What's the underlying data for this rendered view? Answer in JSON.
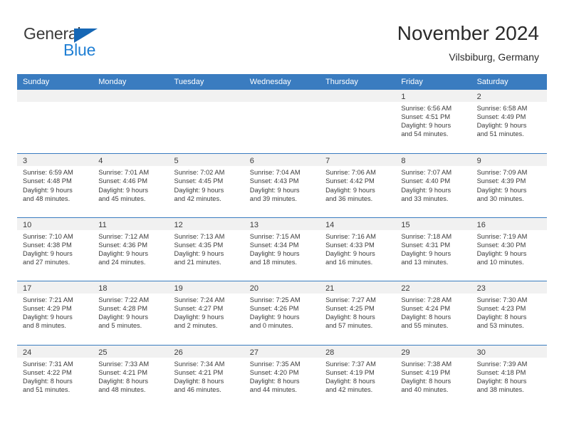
{
  "logo": {
    "word_top": "General",
    "word_bottom": "Blue",
    "triangle_color": "#1667b5",
    "blue_color": "#1f7fd4"
  },
  "header": {
    "month_title": "November 2024",
    "location": "Vilsbiburg, Germany"
  },
  "theme": {
    "header_row_bg": "#3a7cc0",
    "day_strip_bg": "#f1f1f1",
    "text_color": "#3b3b3b"
  },
  "weekdays": [
    "Sunday",
    "Monday",
    "Tuesday",
    "Wednesday",
    "Thursday",
    "Friday",
    "Saturday"
  ],
  "weeks": [
    [
      {
        "day": "",
        "empty": true
      },
      {
        "day": "",
        "empty": true
      },
      {
        "day": "",
        "empty": true
      },
      {
        "day": "",
        "empty": true
      },
      {
        "day": "",
        "empty": true
      },
      {
        "day": "1",
        "sunrise": "Sunrise: 6:56 AM",
        "sunset": "Sunset: 4:51 PM",
        "daylight1": "Daylight: 9 hours",
        "daylight2": "and 54 minutes."
      },
      {
        "day": "2",
        "sunrise": "Sunrise: 6:58 AM",
        "sunset": "Sunset: 4:49 PM",
        "daylight1": "Daylight: 9 hours",
        "daylight2": "and 51 minutes."
      }
    ],
    [
      {
        "day": "3",
        "sunrise": "Sunrise: 6:59 AM",
        "sunset": "Sunset: 4:48 PM",
        "daylight1": "Daylight: 9 hours",
        "daylight2": "and 48 minutes."
      },
      {
        "day": "4",
        "sunrise": "Sunrise: 7:01 AM",
        "sunset": "Sunset: 4:46 PM",
        "daylight1": "Daylight: 9 hours",
        "daylight2": "and 45 minutes."
      },
      {
        "day": "5",
        "sunrise": "Sunrise: 7:02 AM",
        "sunset": "Sunset: 4:45 PM",
        "daylight1": "Daylight: 9 hours",
        "daylight2": "and 42 minutes."
      },
      {
        "day": "6",
        "sunrise": "Sunrise: 7:04 AM",
        "sunset": "Sunset: 4:43 PM",
        "daylight1": "Daylight: 9 hours",
        "daylight2": "and 39 minutes."
      },
      {
        "day": "7",
        "sunrise": "Sunrise: 7:06 AM",
        "sunset": "Sunset: 4:42 PM",
        "daylight1": "Daylight: 9 hours",
        "daylight2": "and 36 minutes."
      },
      {
        "day": "8",
        "sunrise": "Sunrise: 7:07 AM",
        "sunset": "Sunset: 4:40 PM",
        "daylight1": "Daylight: 9 hours",
        "daylight2": "and 33 minutes."
      },
      {
        "day": "9",
        "sunrise": "Sunrise: 7:09 AM",
        "sunset": "Sunset: 4:39 PM",
        "daylight1": "Daylight: 9 hours",
        "daylight2": "and 30 minutes."
      }
    ],
    [
      {
        "day": "10",
        "sunrise": "Sunrise: 7:10 AM",
        "sunset": "Sunset: 4:38 PM",
        "daylight1": "Daylight: 9 hours",
        "daylight2": "and 27 minutes."
      },
      {
        "day": "11",
        "sunrise": "Sunrise: 7:12 AM",
        "sunset": "Sunset: 4:36 PM",
        "daylight1": "Daylight: 9 hours",
        "daylight2": "and 24 minutes."
      },
      {
        "day": "12",
        "sunrise": "Sunrise: 7:13 AM",
        "sunset": "Sunset: 4:35 PM",
        "daylight1": "Daylight: 9 hours",
        "daylight2": "and 21 minutes."
      },
      {
        "day": "13",
        "sunrise": "Sunrise: 7:15 AM",
        "sunset": "Sunset: 4:34 PM",
        "daylight1": "Daylight: 9 hours",
        "daylight2": "and 18 minutes."
      },
      {
        "day": "14",
        "sunrise": "Sunrise: 7:16 AM",
        "sunset": "Sunset: 4:33 PM",
        "daylight1": "Daylight: 9 hours",
        "daylight2": "and 16 minutes."
      },
      {
        "day": "15",
        "sunrise": "Sunrise: 7:18 AM",
        "sunset": "Sunset: 4:31 PM",
        "daylight1": "Daylight: 9 hours",
        "daylight2": "and 13 minutes."
      },
      {
        "day": "16",
        "sunrise": "Sunrise: 7:19 AM",
        "sunset": "Sunset: 4:30 PM",
        "daylight1": "Daylight: 9 hours",
        "daylight2": "and 10 minutes."
      }
    ],
    [
      {
        "day": "17",
        "sunrise": "Sunrise: 7:21 AM",
        "sunset": "Sunset: 4:29 PM",
        "daylight1": "Daylight: 9 hours",
        "daylight2": "and 8 minutes."
      },
      {
        "day": "18",
        "sunrise": "Sunrise: 7:22 AM",
        "sunset": "Sunset: 4:28 PM",
        "daylight1": "Daylight: 9 hours",
        "daylight2": "and 5 minutes."
      },
      {
        "day": "19",
        "sunrise": "Sunrise: 7:24 AM",
        "sunset": "Sunset: 4:27 PM",
        "daylight1": "Daylight: 9 hours",
        "daylight2": "and 2 minutes."
      },
      {
        "day": "20",
        "sunrise": "Sunrise: 7:25 AM",
        "sunset": "Sunset: 4:26 PM",
        "daylight1": "Daylight: 9 hours",
        "daylight2": "and 0 minutes."
      },
      {
        "day": "21",
        "sunrise": "Sunrise: 7:27 AM",
        "sunset": "Sunset: 4:25 PM",
        "daylight1": "Daylight: 8 hours",
        "daylight2": "and 57 minutes."
      },
      {
        "day": "22",
        "sunrise": "Sunrise: 7:28 AM",
        "sunset": "Sunset: 4:24 PM",
        "daylight1": "Daylight: 8 hours",
        "daylight2": "and 55 minutes."
      },
      {
        "day": "23",
        "sunrise": "Sunrise: 7:30 AM",
        "sunset": "Sunset: 4:23 PM",
        "daylight1": "Daylight: 8 hours",
        "daylight2": "and 53 minutes."
      }
    ],
    [
      {
        "day": "24",
        "sunrise": "Sunrise: 7:31 AM",
        "sunset": "Sunset: 4:22 PM",
        "daylight1": "Daylight: 8 hours",
        "daylight2": "and 51 minutes."
      },
      {
        "day": "25",
        "sunrise": "Sunrise: 7:33 AM",
        "sunset": "Sunset: 4:21 PM",
        "daylight1": "Daylight: 8 hours",
        "daylight2": "and 48 minutes."
      },
      {
        "day": "26",
        "sunrise": "Sunrise: 7:34 AM",
        "sunset": "Sunset: 4:21 PM",
        "daylight1": "Daylight: 8 hours",
        "daylight2": "and 46 minutes."
      },
      {
        "day": "27",
        "sunrise": "Sunrise: 7:35 AM",
        "sunset": "Sunset: 4:20 PM",
        "daylight1": "Daylight: 8 hours",
        "daylight2": "and 44 minutes."
      },
      {
        "day": "28",
        "sunrise": "Sunrise: 7:37 AM",
        "sunset": "Sunset: 4:19 PM",
        "daylight1": "Daylight: 8 hours",
        "daylight2": "and 42 minutes."
      },
      {
        "day": "29",
        "sunrise": "Sunrise: 7:38 AM",
        "sunset": "Sunset: 4:19 PM",
        "daylight1": "Daylight: 8 hours",
        "daylight2": "and 40 minutes."
      },
      {
        "day": "30",
        "sunrise": "Sunrise: 7:39 AM",
        "sunset": "Sunset: 4:18 PM",
        "daylight1": "Daylight: 8 hours",
        "daylight2": "and 38 minutes."
      }
    ]
  ]
}
